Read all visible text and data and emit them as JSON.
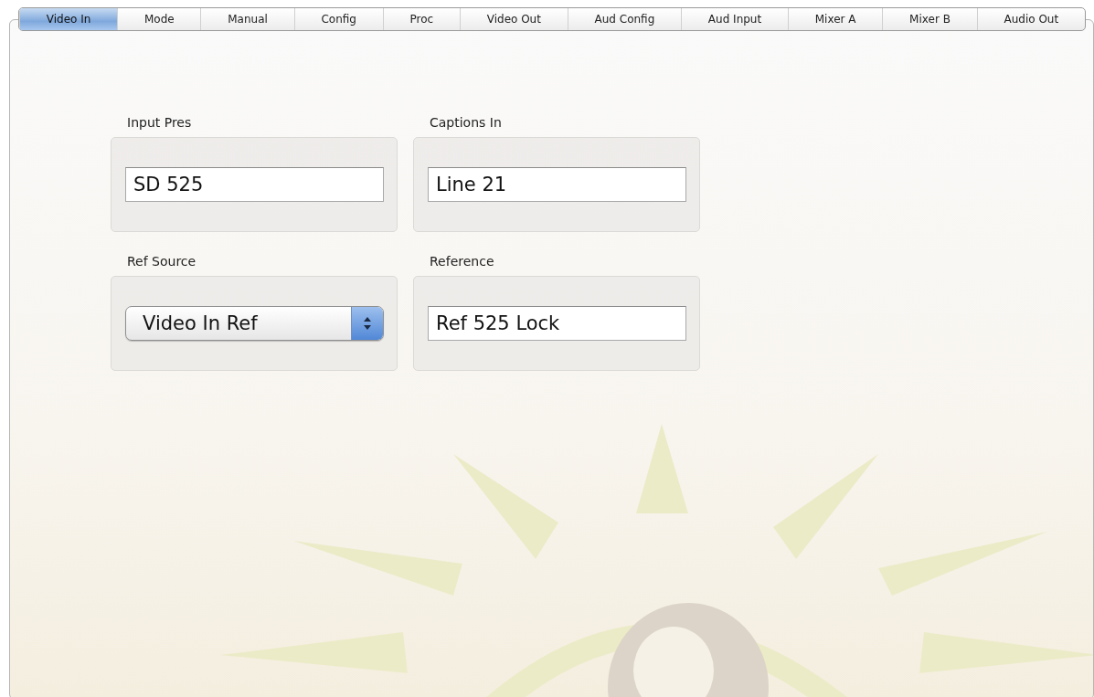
{
  "tabs": [
    {
      "label": "Video In",
      "selected": true
    },
    {
      "label": "Mode",
      "selected": false
    },
    {
      "label": "Manual",
      "selected": false
    },
    {
      "label": "Config",
      "selected": false
    },
    {
      "label": "Proc",
      "selected": false
    },
    {
      "label": "Video Out",
      "selected": false
    },
    {
      "label": "Aud Config",
      "selected": false
    },
    {
      "label": "Aud Input",
      "selected": false
    },
    {
      "label": "Mixer A",
      "selected": false
    },
    {
      "label": "Mixer B",
      "selected": false
    },
    {
      "label": "Audio Out",
      "selected": false
    }
  ],
  "groups": [
    {
      "label": "Input Pres",
      "kind": "text",
      "value": "SD 525"
    },
    {
      "label": "Captions In",
      "kind": "text",
      "value": "Line 21"
    },
    {
      "label": "Ref Source",
      "kind": "select",
      "value": "Video In Ref"
    },
    {
      "label": "Reference",
      "kind": "text",
      "value": "Ref 525 Lock"
    }
  ]
}
